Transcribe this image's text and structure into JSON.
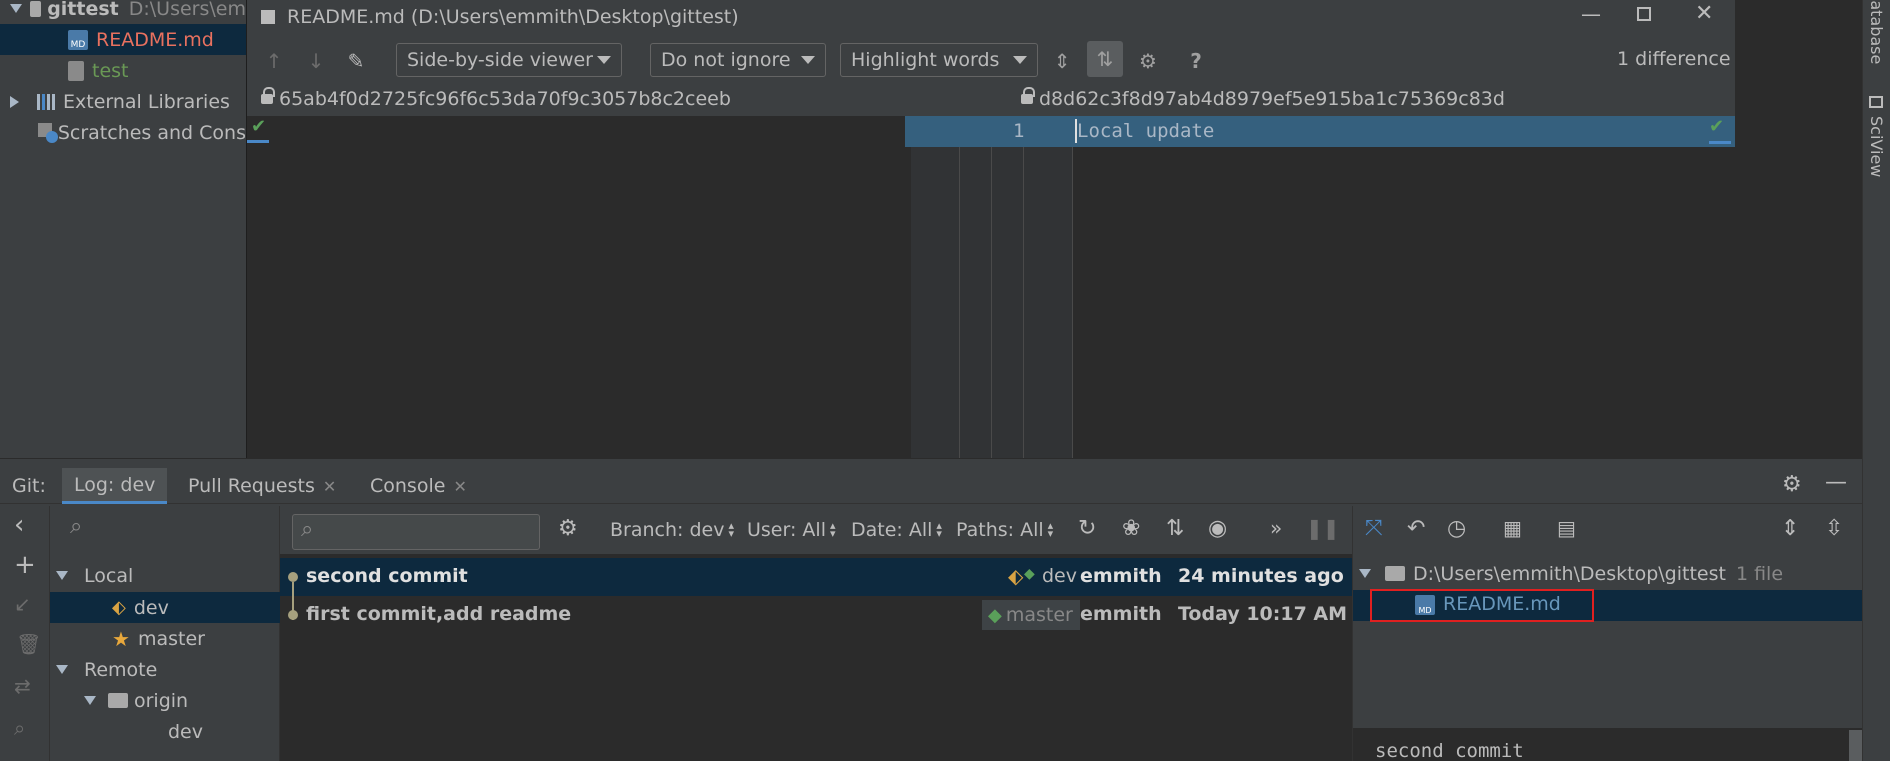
{
  "project_tree": {
    "root": {
      "name": "gittest",
      "path": "D:\\Users\\em"
    },
    "files": [
      {
        "name": "README.md",
        "color": "#e8715f"
      },
      {
        "name": "test",
        "color": "#6a9955"
      }
    ],
    "external_libraries": "External Libraries",
    "scratches": "Scratches and Cons"
  },
  "diff_window": {
    "title": "README.md (D:\\Users\\emmith\\Desktop\\gittest)",
    "viewer": "Side-by-side viewer",
    "ignore": "Do not ignore",
    "highlight": "Highlight words",
    "differences": "1 difference",
    "left_revision": "65ab4f0d2725fc96f6c53da70f9c3057b8c2ceeb",
    "right_revision": "d8d62c3f8d97ab4d8979ef5e915ba1c75369c83d",
    "right_lines": [
      {
        "number": "1",
        "text": "Local update"
      }
    ]
  },
  "git_panel": {
    "label": "Git:",
    "tabs": [
      "Log: dev",
      "Pull Requests",
      "Console"
    ],
    "branches": {
      "local_label": "Local",
      "local": [
        {
          "name": "dev",
          "icon": "tag-icon"
        },
        {
          "name": "master",
          "icon": "star-icon"
        }
      ],
      "remote_label": "Remote",
      "remote_group": "origin",
      "remote_branches": [
        "dev"
      ]
    },
    "filters": {
      "branch": "Branch: dev",
      "user": "User: All",
      "date": "Date: All",
      "paths": "Paths: All"
    },
    "commits": [
      {
        "message": "second commit",
        "ref": "dev",
        "author": "emmith",
        "time": "24 minutes ago"
      },
      {
        "message": "first commit,add readme",
        "ref": "master",
        "author": "emmith",
        "time": "Today 10:17 AM"
      }
    ],
    "changes": {
      "root": "D:\\Users\\emmith\\Desktop\\gittest",
      "count": "1 file",
      "file": "README.md",
      "commit_message_preview": "second commit"
    }
  },
  "right_strip": {
    "database": "Database",
    "sciview": "SciView"
  },
  "colors": {
    "accent": "#4a88c7",
    "selection": "#0d293e",
    "diff_added": "#35607e",
    "tag_green": "#50a050"
  }
}
